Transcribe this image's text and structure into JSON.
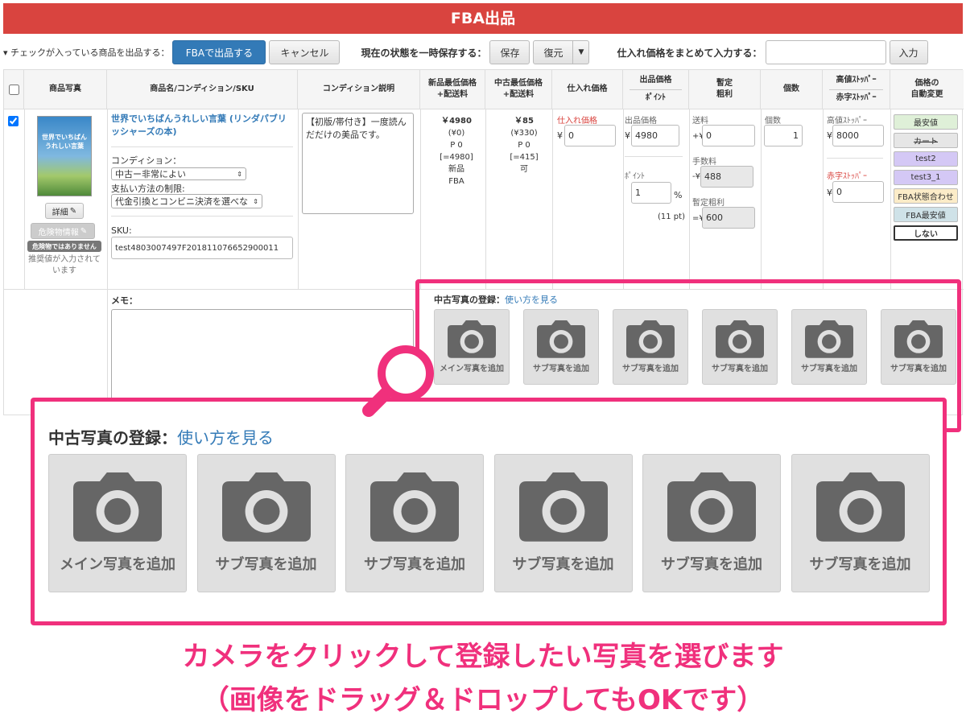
{
  "title": "FBA出品",
  "toolbar": {
    "list_label": "▾ チェックが入っている商品を出品する：",
    "fba_button": "FBAで出品する",
    "cancel_button": "キャンセル",
    "save_state_label": "現在の状態を一時保存する：",
    "save_button": "保存",
    "restore_button": "復元",
    "bulk_price_label": "仕入れ価格をまとめて入力する：",
    "bulk_price_value": "",
    "input_button": "入力"
  },
  "headers": {
    "photo": "商品写真",
    "name": "商品名/コンディション/SKU",
    "condition_desc": "コンディション説明",
    "new_min": [
      "新品最低価格",
      "+配送料"
    ],
    "used_min": [
      "中古最低価格",
      "+配送料"
    ],
    "cost": "仕入れ価格",
    "price": "出品価格",
    "point": "ﾎﾟｲﾝﾄ",
    "profit": [
      "暫定",
      "粗利"
    ],
    "qty": "個数",
    "high_stopper": "高値ｽﾄｯﾊﾟｰ",
    "red_stopper": "赤字ｽﾄｯﾊﾟｰ",
    "auto_change": [
      "価格の",
      "自動変更"
    ]
  },
  "row": {
    "checked": true,
    "book_cover": {
      "line1": "世界でいちばん",
      "line2": "うれしい言葉"
    },
    "detail_button": "詳細",
    "hazard_button": "危険物情報",
    "hazard_badge": "危険物ではありません",
    "recommend_note": [
      "推奨値が入力されて",
      "います"
    ],
    "product_name": [
      "世界でいちばんうれしい言葉 (リンダパブリ",
      "ッシャーズの本)"
    ],
    "condition_label": "コンディション：",
    "condition_value": "中古ー非常によい",
    "payment_label": "支払い方法の制限:",
    "payment_value": "代金引換とコンビニ決済を選べな",
    "sku_label": "SKU:",
    "sku_value": "test4803007497F201811076652900011",
    "condition_desc": "【初版/帯付き】一度読んだだけの美品です。",
    "new_min": [
      "￥4980",
      "(¥0)",
      "P 0",
      "[=4980]",
      "新品",
      "FBA"
    ],
    "used_min": [
      "￥85",
      "(¥330)",
      "P 0",
      "[=415]",
      "可"
    ],
    "cost_label": "仕入れ価格",
    "cost_prefix": "¥",
    "cost_value": "0",
    "price_label": "出品価格",
    "price_prefix": "¥",
    "price_value": "4980",
    "point_label": "ﾎﾟｲﾝﾄ",
    "point_value": "1",
    "point_unit": "%",
    "point_pt": "(11 pt)",
    "shipping_label": "送料",
    "shipping_prefix": "+¥",
    "shipping_value": "0",
    "fee_label": "手数料",
    "fee_prefix": "-¥",
    "fee_value": "488",
    "profit_label": "暫定粗利",
    "profit_prefix": "=¥",
    "profit_value": "600",
    "qty_label": "個数",
    "qty_value": "1",
    "high_label": "高値ｽﾄｯﾊﾟｰ",
    "high_prefix": "¥",
    "high_value": "8000",
    "red_label": "赤字ｽﾄｯﾊﾟｰ",
    "red_prefix": "¥",
    "red_value": "0",
    "auto_options": [
      "最安値",
      "カート",
      "test2",
      "test3_1",
      "FBA状態合わせ",
      "FBA最安値",
      "しない"
    ],
    "memo_label": "メモ："
  },
  "photo_section": {
    "title": "中古写真の登録：",
    "link": "使い方を見る",
    "tiles": [
      "メイン写真を追加",
      "サブ写真を追加",
      "サブ写真を追加",
      "サブ写真を追加",
      "サブ写真を追加",
      "サブ写真を追加"
    ]
  },
  "caption": {
    "line1": "カメラをクリックして登録したい写真を選びます",
    "line2": "（画像をドラッグ＆ドロップしてもOKです）"
  },
  "colors": {
    "title_bg": "#d9443f",
    "primary": "#337ab7",
    "highlight": "#f0307c"
  }
}
